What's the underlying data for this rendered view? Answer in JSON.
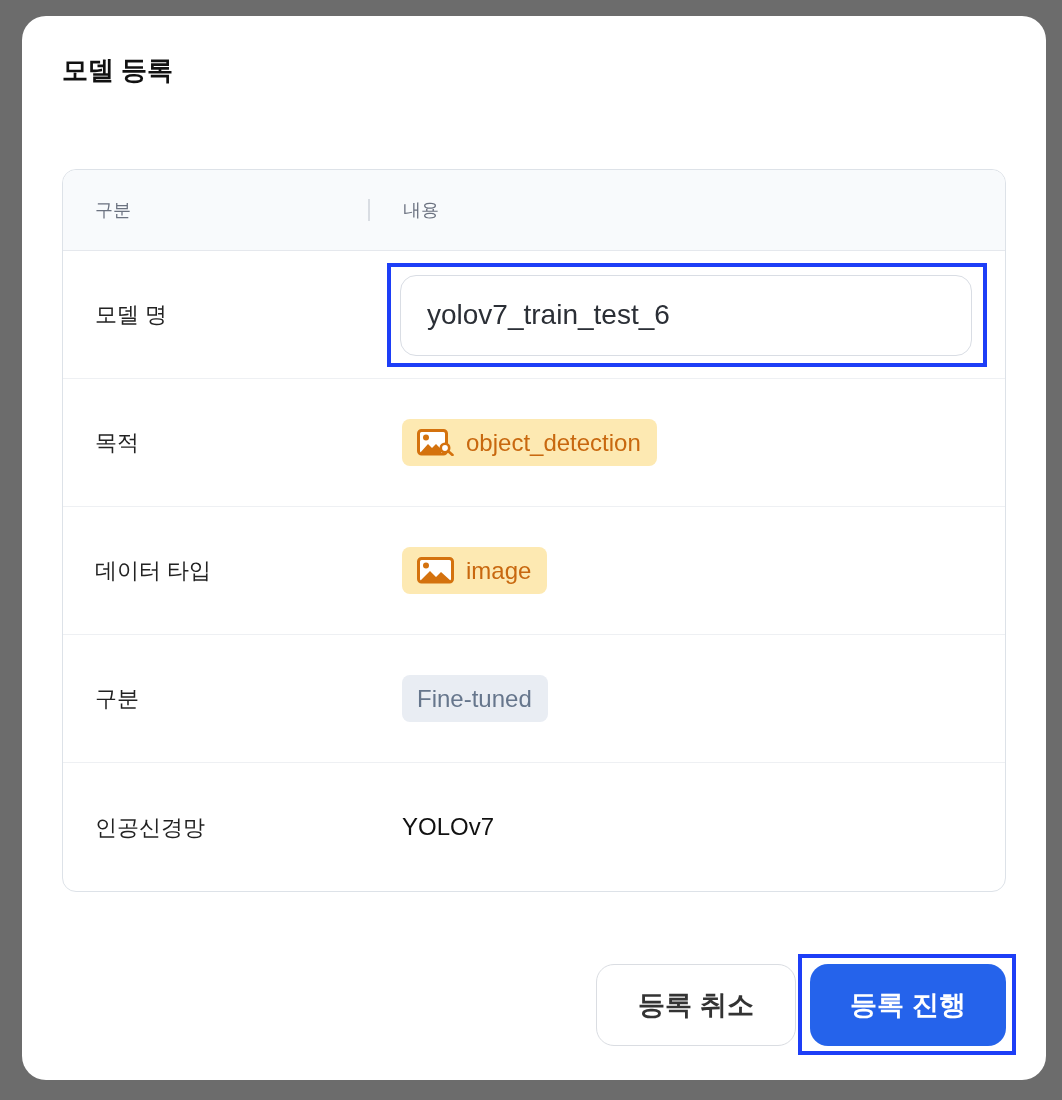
{
  "dialog": {
    "title": "모델 등록"
  },
  "table": {
    "columns": [
      "구분",
      "내용"
    ],
    "rows": [
      {
        "label": "모델 명",
        "kind": "input",
        "value": "yolov7_train_test_6",
        "highlighted": true
      },
      {
        "label": "목적",
        "kind": "task_tag",
        "text": "object_detection",
        "color": "#fde9b2",
        "highlighted": false
      },
      {
        "label": "데이터 타입",
        "kind": "media_tag",
        "text": "image",
        "color": "#fde9b2",
        "highlighted": false
      },
      {
        "label": "구분",
        "kind": "tag",
        "text": "Fine-tuned",
        "color": "#e9edf3",
        "highlighted": false
      },
      {
        "label": "인공신경망",
        "kind": "text",
        "text": "YOLOv7",
        "highlighted": false
      }
    ]
  },
  "buttons": [
    {
      "label": "등록 취소",
      "kind": "secondary",
      "highlighted": false
    },
    {
      "label": "등록 진행",
      "kind": "primary",
      "highlighted": true
    }
  ]
}
